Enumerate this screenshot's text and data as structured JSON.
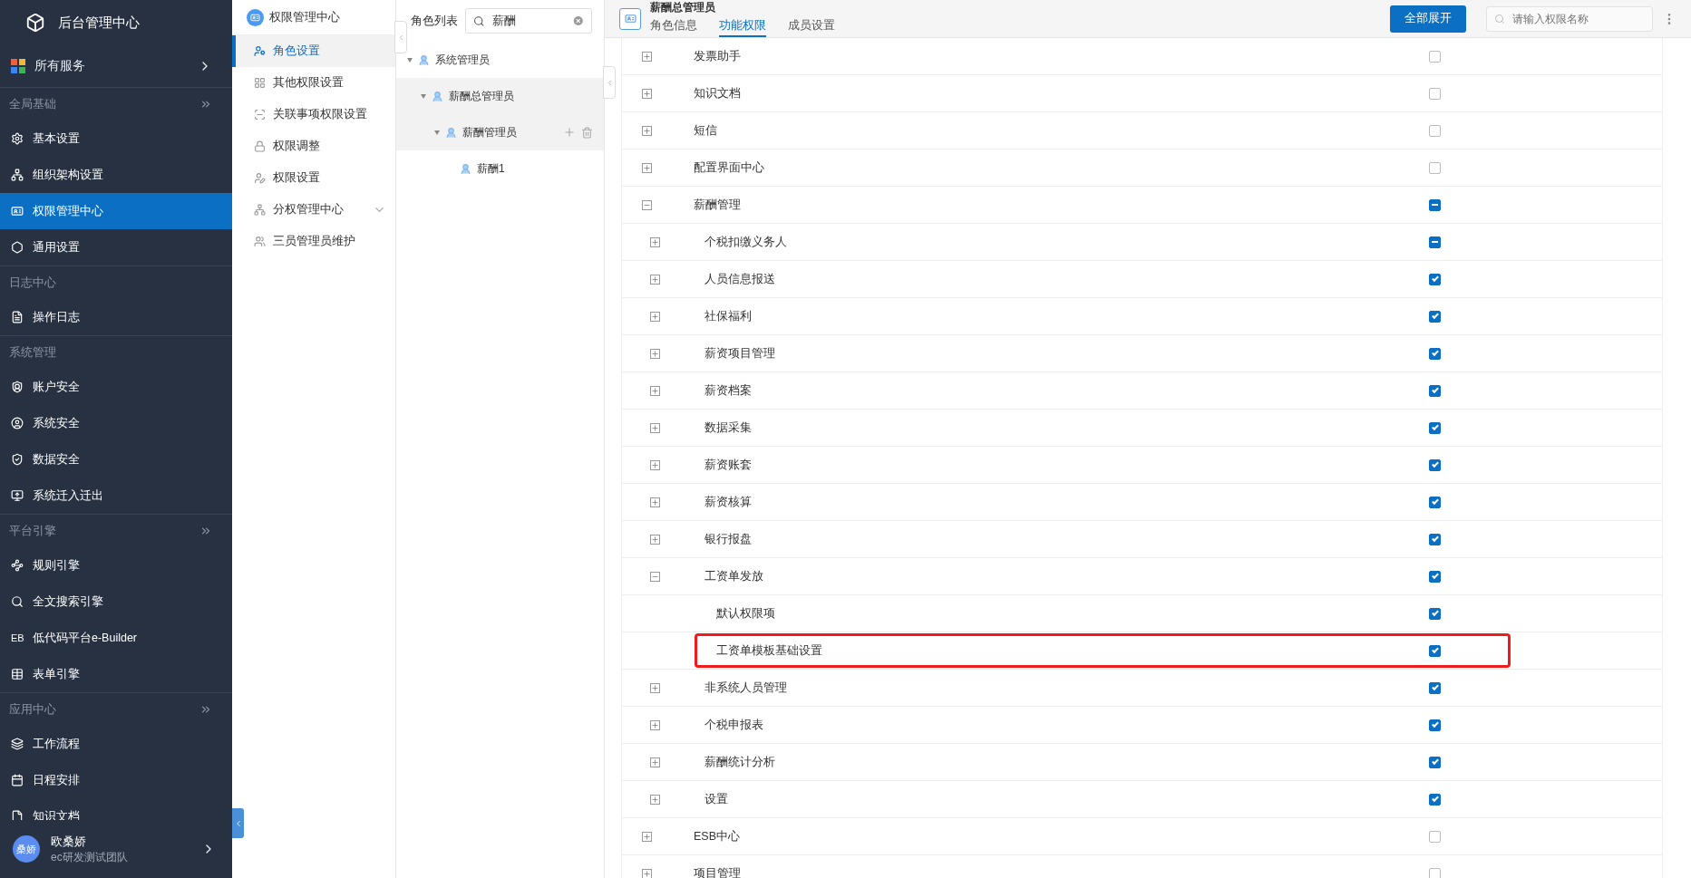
{
  "sidebar": {
    "title": "后台管理中心",
    "services": "所有服务",
    "sections": [
      {
        "title": "全局基础",
        "collapsible": true,
        "items": [
          {
            "label": "基本设置",
            "selected": false
          },
          {
            "label": "组织架构设置",
            "selected": false
          },
          {
            "label": "权限管理中心",
            "selected": true
          },
          {
            "label": "通用设置",
            "selected": false
          }
        ]
      },
      {
        "title": "日志中心",
        "collapsible": false,
        "items": [
          {
            "label": "操作日志",
            "selected": false
          }
        ]
      },
      {
        "title": "系统管理",
        "collapsible": false,
        "items": [
          {
            "label": "账户安全",
            "selected": false
          },
          {
            "label": "系统安全",
            "selected": false
          },
          {
            "label": "数据安全",
            "selected": false
          },
          {
            "label": "系统迁入迁出",
            "selected": false
          }
        ]
      },
      {
        "title": "平台引擎",
        "collapsible": true,
        "items": [
          {
            "label": "规则引擎",
            "selected": false
          },
          {
            "label": "全文搜索引擎",
            "selected": false
          },
          {
            "label": "低代码平台e-Builder",
            "mark": "EB",
            "selected": false
          },
          {
            "label": "表单引擎",
            "selected": false
          }
        ]
      },
      {
        "title": "应用中心",
        "collapsible": true,
        "items": [
          {
            "label": "工作流程",
            "selected": false
          },
          {
            "label": "日程安排",
            "selected": false
          },
          {
            "label": "知识文档",
            "selected": false
          }
        ]
      }
    ],
    "user": {
      "avatar": "桑娇",
      "name": "欧桑娇",
      "team": "ec研发测试团队"
    }
  },
  "submenu": {
    "title": "权限管理中心",
    "items": [
      {
        "label": "角色设置",
        "selected": true
      },
      {
        "label": "其他权限设置",
        "selected": false
      },
      {
        "label": "关联事项权限设置",
        "selected": false
      },
      {
        "label": "权限调整",
        "selected": false
      },
      {
        "label": "权限设置",
        "selected": false,
        "children_expandable": false
      },
      {
        "label": "分权管理中心",
        "selected": false,
        "children_expandable": true
      },
      {
        "label": "三员管理员维护",
        "selected": false
      }
    ]
  },
  "roles": {
    "title": "角色列表",
    "search": "薪酬",
    "tree": [
      {
        "label": "系统管理员",
        "selected": false,
        "hover": false,
        "expanded": true,
        "children": [
          {
            "label": "薪酬总管理员",
            "selected": true,
            "hover": false,
            "expanded": true,
            "children": [
              {
                "label": "薪酬管理员",
                "selected": true,
                "hover": true,
                "expanded": true,
                "children": [
                  {
                    "label": "薪酬1",
                    "selected": false,
                    "hover": false
                  }
                ]
              }
            ]
          }
        ]
      }
    ]
  },
  "main": {
    "title": "薪酬总管理员",
    "tabs": [
      {
        "label": "角色信息",
        "selected": false
      },
      {
        "label": "功能权限",
        "selected": true
      },
      {
        "label": "成员设置",
        "selected": false
      }
    ],
    "expand_all": "全部展开",
    "search_placeholder": "请输入权限名称",
    "permissions": [
      {
        "label": "发票助手",
        "expanded": false,
        "checked": false,
        "partial": false
      },
      {
        "label": "知识文档",
        "expanded": false,
        "checked": false,
        "partial": false
      },
      {
        "label": "短信",
        "expanded": false,
        "checked": false,
        "partial": false
      },
      {
        "label": "配置界面中心",
        "expanded": false,
        "checked": false,
        "partial": false
      },
      {
        "label": "薪酬管理",
        "expanded": true,
        "checked": false,
        "partial": true,
        "children": [
          {
            "label": "个税扣缴义务人",
            "expanded": false,
            "checked": false,
            "partial": true
          },
          {
            "label": "人员信息报送",
            "expanded": false,
            "checked": true,
            "partial": false
          },
          {
            "label": "社保福利",
            "expanded": false,
            "checked": true,
            "partial": false
          },
          {
            "label": "薪资项目管理",
            "expanded": false,
            "checked": true,
            "partial": false
          },
          {
            "label": "薪资档案",
            "expanded": false,
            "checked": true,
            "partial": false
          },
          {
            "label": "数据采集",
            "expanded": false,
            "checked": true,
            "partial": false
          },
          {
            "label": "薪资账套",
            "expanded": false,
            "checked": true,
            "partial": false
          },
          {
            "label": "薪资核算",
            "expanded": false,
            "checked": true,
            "partial": false
          },
          {
            "label": "银行报盘",
            "expanded": false,
            "checked": true,
            "partial": false
          },
          {
            "label": "工资单发放",
            "expanded": true,
            "checked": true,
            "partial": false,
            "children": [
              {
                "label": "默认权限项",
                "checked": true,
                "partial": false,
                "highlighted": false
              },
              {
                "label": "工资单模板基础设置",
                "checked": true,
                "partial": false,
                "highlighted": true
              }
            ]
          },
          {
            "label": "非系统人员管理",
            "expanded": false,
            "checked": true,
            "partial": false
          },
          {
            "label": "个税申报表",
            "expanded": false,
            "checked": true,
            "partial": false
          },
          {
            "label": "薪酬统计分析",
            "expanded": false,
            "checked": true,
            "partial": false
          },
          {
            "label": "设置",
            "expanded": false,
            "checked": true,
            "partial": false
          }
        ]
      },
      {
        "label": "ESB中心",
        "expanded": false,
        "checked": false,
        "partial": false
      },
      {
        "label": "项目管理",
        "expanded": false,
        "checked": false,
        "partial": false
      }
    ]
  }
}
